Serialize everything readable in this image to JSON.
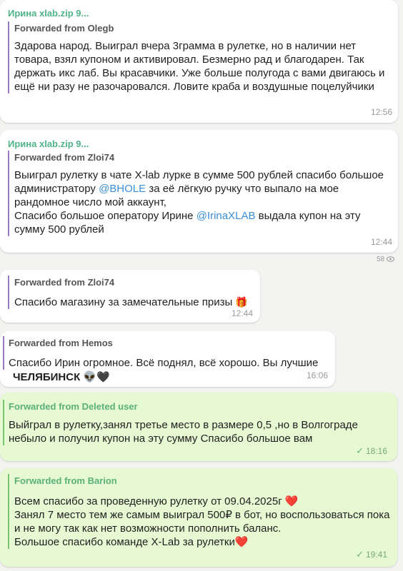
{
  "messages": [
    {
      "sender": "Ирина xlab.zip 9...",
      "forwarded_from": "Forwarded from Olegb",
      "text": "Здарова народ. Выиграл вчера 3грамма в рулетке, но в наличии нет товара, взял купоном и активировал. Безмерно рад и благодарен. Так держать икс лаб. Вы красавчики. Уже больше полугода с вами двигаюсь и ещё ни разу не разочаровался. Ловите краба и воздушные поцелуйчики",
      "time": "12:56"
    },
    {
      "sender": "Ирина xlab.zip 9...",
      "forwarded_from": "Forwarded from Zloi74",
      "text_part1": "Выиграл рулетку в чате X-lab лурке  в сумме 500 рублей спасибо большое администратору ",
      "mention1": "@BHOLE",
      "text_part2": " за её лёгкую ручку что выпало на мое рандомное число мой аккаунт,\nСпасибо большое оператору Ирине ",
      "mention2": "@IrinaXLAB",
      "text_part3": "  выдала купон на эту сумму 500 рублей",
      "time": "12:44",
      "views": "58"
    },
    {
      "forwarded_from": "Forwarded from Zloi74",
      "text": "Спасибо магазину за замечательные призы",
      "emoji": "🎁",
      "time": "12:44"
    },
    {
      "forwarded_from": "Forwarded from Hemos",
      "text": "Спасибо Ирин огромное. Всё поднял, всё хорошо. Вы лучшие",
      "text2": "ЧЕЛЯБИНСК 👽🖤",
      "time": "16:06"
    },
    {
      "forwarded_from": "Forwarded from Deleted user",
      "text": "Выйграл в рулетку,занял   третье место в  размере 0,5 ,но в Волгограде небыло и получил купон на  эту сумму Спасибо большое вам",
      "time": "18:16"
    },
    {
      "forwarded_from": "Forwarded from Barion",
      "text": "Всем спасибо за проведенную рулетку от 09.04.2025г ❤️\nЗанял 7 место тем же самым выиграл 500₽ в бот, но воспользоваться пока и не могу так как нет возможности пополнить баланс.\nБольшое спасибо команде X-Lab за рулетки❤️",
      "time": "19:41"
    }
  ],
  "colors": {
    "background": "#f3f3f1",
    "incoming_bubble": "#ffffff",
    "outgoing_bubble": "#e6f9d2",
    "sender": "#4fb488",
    "forward_bar": "#9a79c8",
    "mention": "#3a8fd8"
  },
  "icons": {
    "read_check": "double-check-icon",
    "views": "eye-icon"
  }
}
